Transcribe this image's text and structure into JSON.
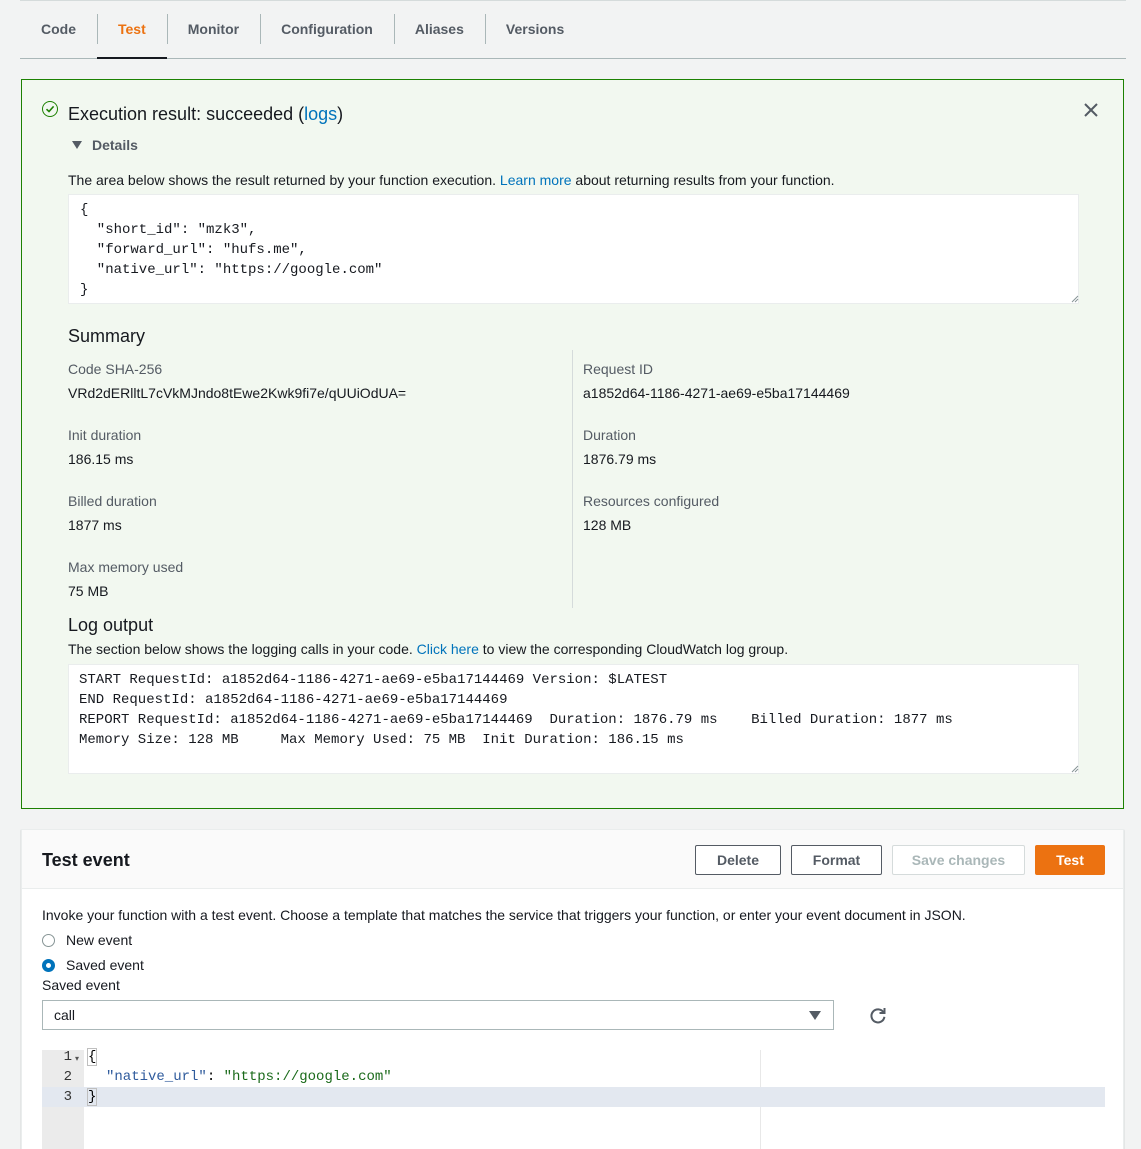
{
  "tabs": [
    {
      "label": "Code",
      "active": false
    },
    {
      "label": "Test",
      "active": true
    },
    {
      "label": "Monitor",
      "active": false
    },
    {
      "label": "Configuration",
      "active": false
    },
    {
      "label": "Aliases",
      "active": false
    },
    {
      "label": "Versions",
      "active": false
    }
  ],
  "result": {
    "title_prefix": "Execution result: succeeded (",
    "logs_link": "logs",
    "title_suffix": ")",
    "details_label": "Details",
    "desc_prefix": "The area below shows the result returned by your function execution. ",
    "learn_more": "Learn more",
    "desc_suffix": " about returning results from your function.",
    "output": "{\n  \"short_id\": \"mzk3\",\n  \"forward_url\": \"hufs.me\",\n  \"native_url\": \"https://google.com\"\n}",
    "status_color": "#1d8102"
  },
  "summary": {
    "title": "Summary",
    "code_sha_label": "Code SHA-256",
    "code_sha_value": "VRd2dERlltL7cVkMJndo8tEwe2Kwk9fi7e/qUUiOdUA=",
    "request_id_label": "Request ID",
    "request_id_value": "a1852d64-1186-4271-ae69-e5ba17144469",
    "init_duration_label": "Init duration",
    "init_duration_value": "186.15 ms",
    "duration_label": "Duration",
    "duration_value": "1876.79 ms",
    "billed_duration_label": "Billed duration",
    "billed_duration_value": "1877 ms",
    "resources_label": "Resources configured",
    "resources_value": "128 MB",
    "max_memory_label": "Max memory used",
    "max_memory_value": "75 MB"
  },
  "log": {
    "title": "Log output",
    "desc_prefix": "The section below shows the logging calls in your code. ",
    "click_here": "Click here",
    "desc_suffix": " to view the corresponding CloudWatch log group.",
    "output": "START RequestId: a1852d64-1186-4271-ae69-e5ba17144469 Version: $LATEST\nEND RequestId: a1852d64-1186-4271-ae69-e5ba17144469\nREPORT RequestId: a1852d64-1186-4271-ae69-e5ba17144469  Duration: 1876.79 ms    Billed Duration: 1877 ms\nMemory Size: 128 MB     Max Memory Used: 75 MB  Init Duration: 186.15 ms"
  },
  "test_event": {
    "title": "Test event",
    "delete_label": "Delete",
    "format_label": "Format",
    "save_label": "Save changes",
    "test_label": "Test",
    "description": "Invoke your function with a test event. Choose a template that matches the service that triggers your function, or enter your event document in JSON.",
    "new_event_label": "New event",
    "saved_event_radio_label": "Saved event",
    "selected_option": "saved",
    "saved_event_field_label": "Saved event",
    "saved_event_value": "call",
    "accent_color": "#ec7211",
    "editor": {
      "lines": [
        {
          "num": "1",
          "open": "{"
        },
        {
          "num": "2",
          "key": "\"native_url\"",
          "colon": ": ",
          "value": "\"https://google.com\""
        },
        {
          "num": "3",
          "close": "}"
        }
      ]
    }
  }
}
